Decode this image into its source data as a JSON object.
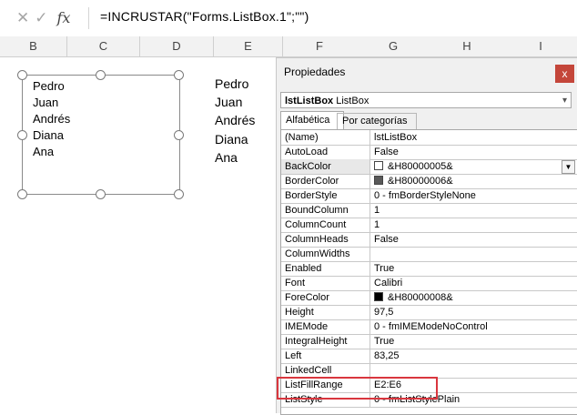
{
  "formula_bar": {
    "cancel_icon": "x-icon",
    "enter_icon": "check-icon",
    "function_icon": "fx-icon",
    "function_label": "fx",
    "formula": "=INCRUSTAR(\"Forms.ListBox.1\";\"\")"
  },
  "columns": [
    "B",
    "C",
    "D",
    "E",
    "F",
    "G",
    "H",
    "I"
  ],
  "listbox_items": [
    "Pedro",
    "Juan",
    "Andrés",
    "Diana",
    "Ana"
  ],
  "cells_E": [
    "Pedro",
    "Juan",
    "Andrés",
    "Diana",
    "Ana"
  ],
  "properties": {
    "title": "Propiedades",
    "close_label": "x",
    "object_name": "lstListBox",
    "object_type": "ListBox",
    "tabs": [
      "Alfabética",
      "Por categorías"
    ],
    "rows": [
      {
        "name": "(Name)",
        "value": "lstListBox"
      },
      {
        "name": "AutoLoad",
        "value": "False"
      },
      {
        "name": "BackColor",
        "value": "&H80000005&",
        "swatch": "#ffffff"
      },
      {
        "name": "BorderColor",
        "value": "&H80000006&",
        "swatch": "#595959"
      },
      {
        "name": "BorderStyle",
        "value": "0 - fmBorderStyleNone"
      },
      {
        "name": "BoundColumn",
        "value": "1"
      },
      {
        "name": "ColumnCount",
        "value": "1"
      },
      {
        "name": "ColumnHeads",
        "value": "False"
      },
      {
        "name": "ColumnWidths",
        "value": ""
      },
      {
        "name": "Enabled",
        "value": "True"
      },
      {
        "name": "Font",
        "value": "Calibri"
      },
      {
        "name": "ForeColor",
        "value": "&H80000008&",
        "swatch": "#000000"
      },
      {
        "name": "Height",
        "value": "97,5"
      },
      {
        "name": "IMEMode",
        "value": "0 - fmIMEModeNoControl"
      },
      {
        "name": "IntegralHeight",
        "value": "True"
      },
      {
        "name": "Left",
        "value": "83,25"
      },
      {
        "name": "LinkedCell",
        "value": ""
      },
      {
        "name": "ListFillRange",
        "value": "E2:E6"
      },
      {
        "name": "ListStyle",
        "value": "0 - fmListStylePlain"
      }
    ]
  },
  "colors": {
    "highlight": "#d9363e",
    "close_button": "#c4463a"
  }
}
